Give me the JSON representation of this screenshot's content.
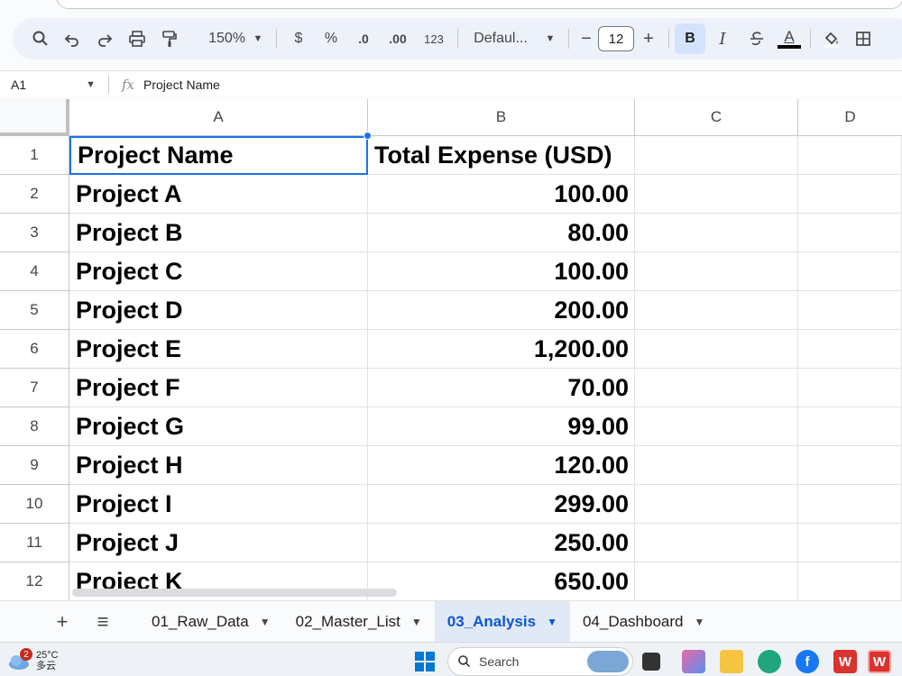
{
  "toolbar": {
    "zoom": "150%",
    "currency": "$",
    "percent": "%",
    "decrease_decimal": ".0",
    "increase_decimal": ".00",
    "number_format": "123",
    "font": "Defaul...",
    "font_size": "12",
    "minus": "−",
    "plus": "+",
    "bold": "B",
    "italic": "I",
    "text_color": "A"
  },
  "formula_bar": {
    "cell_ref": "A1",
    "fx": "fx",
    "content": "Project Name"
  },
  "columns": [
    "A",
    "B",
    "C",
    "D"
  ],
  "rows": [
    {
      "num": "1",
      "a": "Project Name",
      "b": "Total Expense (USD)"
    },
    {
      "num": "2",
      "a": "Project A",
      "b": "100.00"
    },
    {
      "num": "3",
      "a": "Project B",
      "b": "80.00"
    },
    {
      "num": "4",
      "a": "Project C",
      "b": "100.00"
    },
    {
      "num": "5",
      "a": "Project D",
      "b": "200.00"
    },
    {
      "num": "6",
      "a": "Project E",
      "b": "1,200.00"
    },
    {
      "num": "7",
      "a": "Project F",
      "b": "70.00"
    },
    {
      "num": "8",
      "a": "Project G",
      "b": "99.00"
    },
    {
      "num": "9",
      "a": "Project H",
      "b": "120.00"
    },
    {
      "num": "10",
      "a": "Project I",
      "b": "299.00"
    },
    {
      "num": "11",
      "a": "Project J",
      "b": "250.00"
    },
    {
      "num": "12",
      "a": "Project K",
      "b": "650.00"
    }
  ],
  "sheets": {
    "add": "+",
    "menu": "≡",
    "tabs": [
      "01_Raw_Data",
      "02_Master_List",
      "03_Analysis",
      "04_Dashboard"
    ],
    "active": "03_Analysis"
  },
  "taskbar": {
    "temperature": "25°C",
    "weather": "多云",
    "notification_count": "2",
    "search": "Search"
  },
  "colors": {
    "accent": "#1a73e8",
    "active_tab_text": "#0b57d0",
    "active_tab_bg": "#e1e9f7",
    "toolbar_bg": "#edf2fa"
  }
}
